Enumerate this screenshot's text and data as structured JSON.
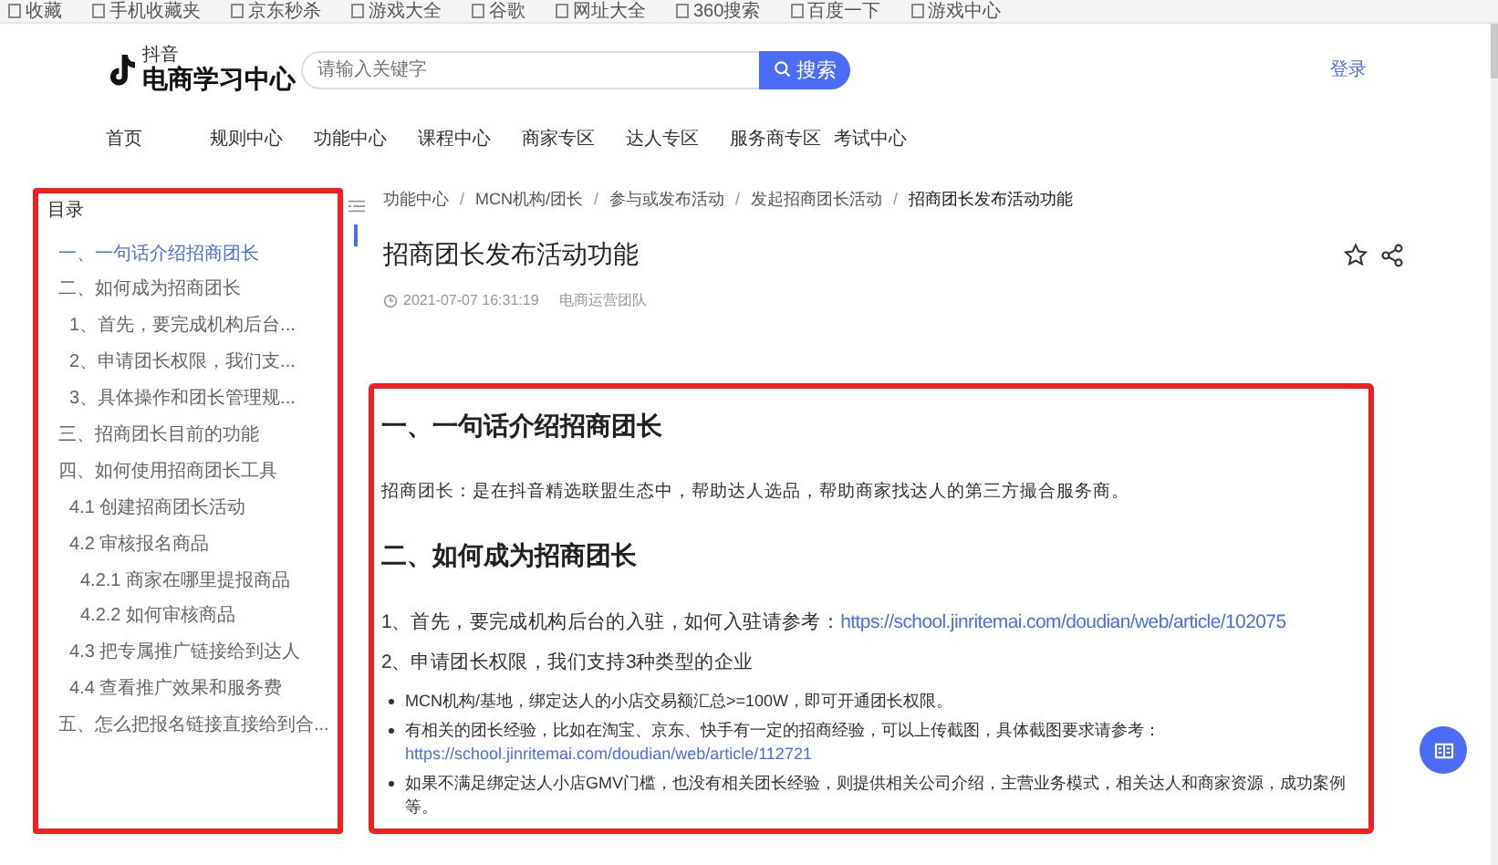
{
  "bookmarks_bar": {
    "items": [
      {
        "label": "收藏"
      },
      {
        "label": "手机收藏夹"
      },
      {
        "label": "京东秒杀"
      },
      {
        "label": "游戏大全"
      },
      {
        "label": "谷歌"
      },
      {
        "label": "网址大全"
      },
      {
        "label": "360搜索"
      },
      {
        "label": "百度一下"
      },
      {
        "label": "游戏中心"
      }
    ]
  },
  "header": {
    "logo": {
      "caption": "抖音",
      "title": "电商学习中心"
    },
    "search": {
      "placeholder": "请输入关键字",
      "button": "搜索"
    },
    "login": "登录"
  },
  "nav": [
    {
      "label": "首页"
    },
    {
      "label": "规则中心"
    },
    {
      "label": "功能中心"
    },
    {
      "label": "课程中心"
    },
    {
      "label": "商家专区"
    },
    {
      "label": "达人专区"
    },
    {
      "label": "服务商专区"
    },
    {
      "label": "考试中心"
    }
  ],
  "toc": {
    "title": "目录",
    "items": [
      {
        "label": "一、一句话介绍招商团长",
        "selected": true
      },
      {
        "label": "二、如何成为招商团长",
        "selected": false,
        "children": [
          {
            "label": "1、首先，要完成机构后台...",
            "selected": false
          },
          {
            "label": "2、申请团长权限，我们支...",
            "selected": false
          },
          {
            "label": "3、具体操作和团长管理规...",
            "selected": false
          }
        ]
      },
      {
        "label": "三、招商团长目前的功能",
        "selected": false
      },
      {
        "label": "四、如何使用招商团长工具",
        "selected": false,
        "children": [
          {
            "label": "4.1 创建招商团长活动",
            "selected": false
          },
          {
            "label": "4.2 审核报名商品",
            "selected": false,
            "children": [
              {
                "label": "4.2.1 商家在哪里提报商品",
                "selected": false
              },
              {
                "label": "4.2.2 如何审核商品",
                "selected": false
              }
            ]
          },
          {
            "label": "4.3 把专属推广链接给到达人",
            "selected": false
          },
          {
            "label": "4.4 查看推广效果和服务费",
            "selected": false
          }
        ]
      },
      {
        "label": "五、怎么把报名链接直接给到合...",
        "selected": false
      }
    ]
  },
  "breadcrumb": [
    {
      "kind": "link",
      "text": "功能中心"
    },
    {
      "kind": "separator",
      "text": "/"
    },
    {
      "kind": "link",
      "text": "MCN机构/团长"
    },
    {
      "kind": "separator",
      "text": "/"
    },
    {
      "kind": "link",
      "text": "参与或发布活动"
    },
    {
      "kind": "separator",
      "text": "/"
    },
    {
      "kind": "link",
      "text": "发起招商团长活动"
    },
    {
      "kind": "separator",
      "text": "/"
    },
    {
      "kind": "current",
      "text": "招商团长发布活动功能"
    }
  ],
  "article": {
    "title": "招商团长发布活动功能",
    "date": "2021-07-07 16:31:19",
    "author": "电商运营团队",
    "blocks": [
      {
        "kind": "heading",
        "text": "一、一句话介绍招商团长"
      },
      {
        "kind": "paragraph",
        "text": "招商团长：是在抖音精选联盟生态中，帮助达人选品，帮助商家找达人的第三方撮合服务商。"
      },
      {
        "kind": "heading",
        "text": "二、如何成为招商团长"
      },
      {
        "kind": "numbered",
        "text": "1、首先，要完成机构后台的入驻，如何入驻请参考：",
        "link": "https://school.jinritemai.com/doudian/web/article/102075"
      },
      {
        "kind": "numbered",
        "text": "2、申请团长权限，我们支持3种类型的企业"
      },
      {
        "kind": "bullet",
        "text": "MCN机构/基地，绑定达人的小店交易额汇总>=100W，即可开通团长权限。"
      },
      {
        "kind": "bullet",
        "text": "有相关的团长经验，比如在淘宝、京东、快手有一定的招商经验，可以上传截图，具体截图要求请参考：",
        "link": "https://school.jinritemai.com/doudian/web/article/112721"
      },
      {
        "kind": "bullet",
        "text": "如果不满足绑定达人小店GMV门槛，也没有相关团长经验，则提供相关公司介绍，主营业务模式，相关达人和商家资源，成功案例等。"
      }
    ]
  }
}
